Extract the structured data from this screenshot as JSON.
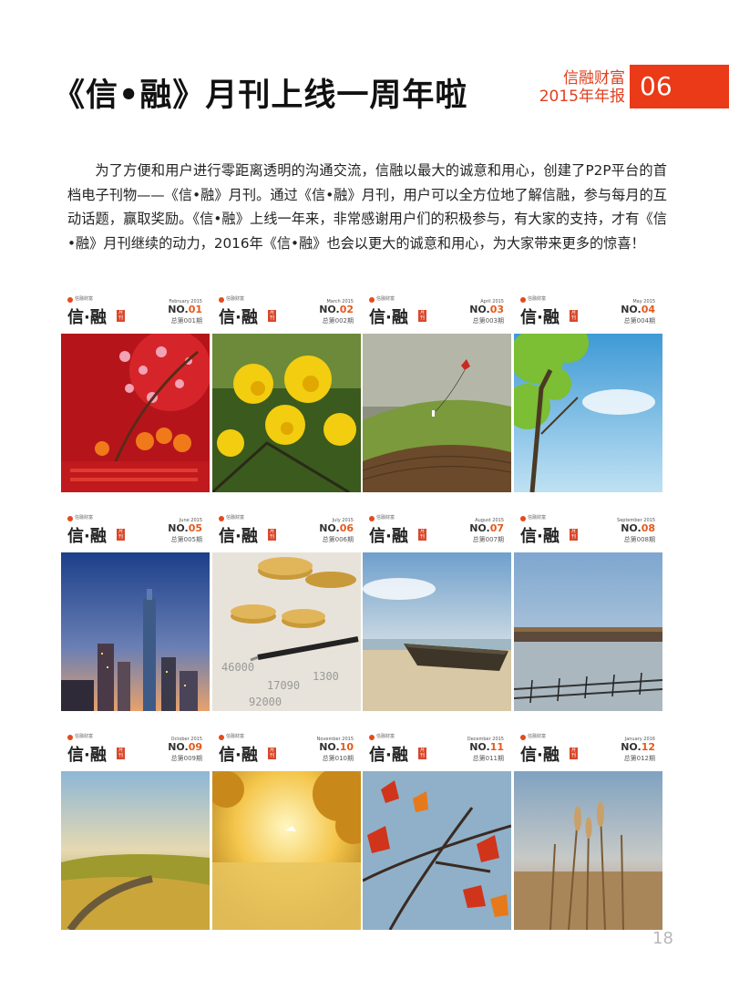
{
  "title": "《信•融》月刊上线一周年啦",
  "brand": {
    "line1": "信融财富",
    "line2": "2015年年报",
    "section": "06"
  },
  "intro": "为了方便和用户进行零距离透明的沟通交流，信融以最大的诚意和用心，创建了P2P平台的首档电子刊物——《信•融》月刊。通过《信•融》月刊，用户可以全方位地了解信融，参与每月的互动话题，赢取奖励。《信•融》上线一年来，非常感谢用户们的积极参与，有大家的支持，才有《信•融》月刊继续的动力，2016年《信•融》也会以更大的诚意和用心，为大家带来更多的惊喜！",
  "covers": [
    {
      "date": "February 2015",
      "no": "NO.",
      "num": "01",
      "total": "总第001期"
    },
    {
      "date": "March 2015",
      "no": "NO.",
      "num": "02",
      "total": "总第002期"
    },
    {
      "date": "April 2015",
      "no": "NO.",
      "num": "03",
      "total": "总第003期"
    },
    {
      "date": "May 2015",
      "no": "NO.",
      "num": "04",
      "total": "总第004期"
    },
    {
      "date": "June 2015",
      "no": "NO.",
      "num": "05",
      "total": "总第005期"
    },
    {
      "date": "July 2015",
      "no": "NO.",
      "num": "06",
      "total": "总第006期"
    },
    {
      "date": "August 2015",
      "no": "NO.",
      "num": "07",
      "total": "总第007期"
    },
    {
      "date": "September 2015",
      "no": "NO.",
      "num": "08",
      "total": "总第008期"
    },
    {
      "date": "October 2015",
      "no": "NO.",
      "num": "09",
      "total": "总第009期"
    },
    {
      "date": "November 2015",
      "no": "NO.",
      "num": "10",
      "total": "总第010期"
    },
    {
      "date": "December 2015",
      "no": "NO.",
      "num": "11",
      "total": "总第011期"
    },
    {
      "date": "January 2016",
      "no": "NO.",
      "num": "12",
      "total": "总第012期"
    }
  ],
  "cover_common": {
    "publisher": "信融财富",
    "mag_name": "信·融",
    "badge": "月刊"
  },
  "cover_art": [
    "chinese-new-year-blossom-oranges",
    "yellow-flowers",
    "kite-green-hill",
    "tree-blue-sky",
    "city-skyline-dusk",
    "coins-pen-ledger",
    "boat-on-beach",
    "lake-pier-reflection",
    "golden-field-road",
    "sunlit-lake-tree",
    "red-maple-leaves",
    "wheat-field"
  ],
  "page_number": "18"
}
